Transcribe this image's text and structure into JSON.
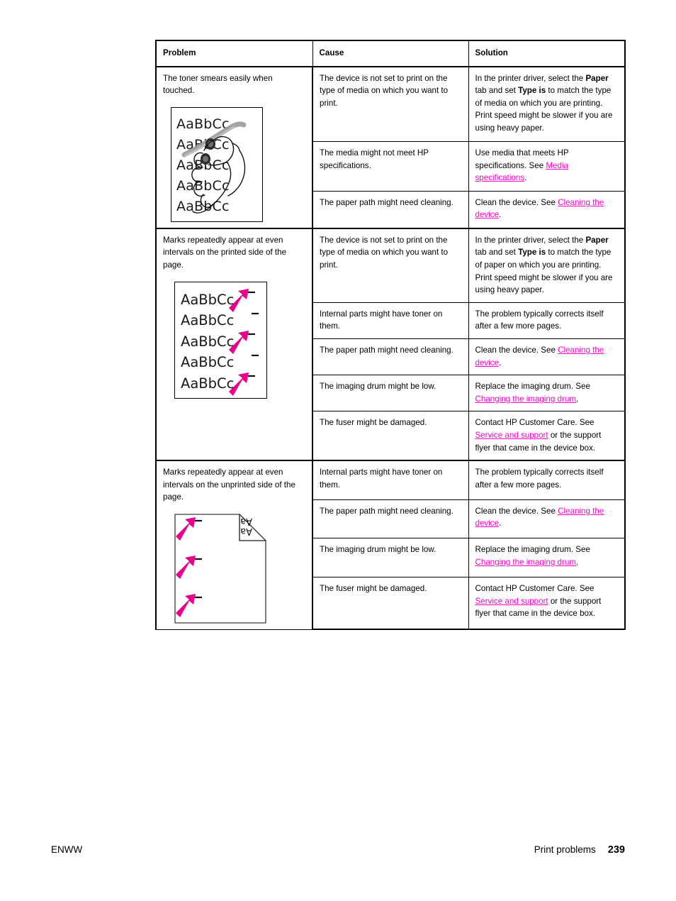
{
  "document": {
    "footer_left": "ENWW",
    "footer_section": "Print problems",
    "footer_page": "239"
  },
  "colors": {
    "link": "#ff00cc",
    "text": "#000000",
    "arrow": "#e8008c",
    "border": "#000000"
  },
  "table": {
    "headers": {
      "problem": "Problem",
      "cause": "Cause",
      "solution": "Solution"
    },
    "groups": [
      {
        "problem_text": "The toner smears easily when touched.",
        "figure": "toner-smear-hand-illustration",
        "figure_sample_lines": [
          "AaBbCc",
          "AaBbCc",
          "AaBbCc",
          "AaBbCc",
          "AaBbCc"
        ],
        "rows": [
          {
            "cause": "The device is not set to print on the type of media on which you want to print.",
            "solution_parts": [
              {
                "t": "text",
                "v": "In the printer driver, select the "
              },
              {
                "t": "bold",
                "v": "Paper"
              },
              {
                "t": "text",
                "v": " tab and set "
              },
              {
                "t": "bold",
                "v": "Type is"
              },
              {
                "t": "text",
                "v": " to match the type of media on which you are printing. Print speed might be slower if you are using heavy paper."
              }
            ]
          },
          {
            "cause": "The media might not meet HP specifications.",
            "solution_parts": [
              {
                "t": "text",
                "v": "Use media that meets HP specifications. See "
              },
              {
                "t": "link",
                "v": "Media specifications"
              },
              {
                "t": "text",
                "v": "."
              }
            ]
          },
          {
            "cause": "The paper path might need cleaning.",
            "solution_parts": [
              {
                "t": "text",
                "v": "Clean the device. See "
              },
              {
                "t": "link",
                "v": "Cleaning the device"
              },
              {
                "t": "text",
                "v": "."
              }
            ]
          }
        ]
      },
      {
        "problem_text": "Marks repeatedly appear at even intervals on the printed side of the page.",
        "figure": "repeated-marks-printed-side-illustration",
        "figure_sample_lines": [
          "AaBbCc",
          "AaBbCc",
          "AaBbCc",
          "AaBbCc",
          "AaBbCc"
        ],
        "rows": [
          {
            "cause": "The device is not set to print on the type of media on which you want to print.",
            "solution_parts": [
              {
                "t": "text",
                "v": "In the printer driver, select the "
              },
              {
                "t": "bold",
                "v": "Paper"
              },
              {
                "t": "text",
                "v": " tab and set "
              },
              {
                "t": "bold",
                "v": "Type is"
              },
              {
                "t": "text",
                "v": " to match the type of paper on which you are printing. Print speed might be slower if you are using heavy paper."
              }
            ]
          },
          {
            "cause": "Internal parts might have toner on them.",
            "solution_parts": [
              {
                "t": "text",
                "v": "The problem typically corrects itself after a few more pages."
              }
            ]
          },
          {
            "cause": "The paper path might need cleaning.",
            "solution_parts": [
              {
                "t": "text",
                "v": "Clean the device. See "
              },
              {
                "t": "link",
                "v": "Cleaning the device"
              },
              {
                "t": "text",
                "v": "."
              }
            ]
          },
          {
            "cause": "The imaging drum might be low.",
            "solution_parts": [
              {
                "t": "text",
                "v": "Replace the imaging drum. See "
              },
              {
                "t": "link",
                "v": "Changing the imaging drum"
              },
              {
                "t": "text",
                "v": "."
              }
            ]
          },
          {
            "cause": "The fuser might be damaged.",
            "solution_parts": [
              {
                "t": "text",
                "v": "Contact HP Customer Care. See "
              },
              {
                "t": "link",
                "v": "Service and support"
              },
              {
                "t": "text",
                "v": " or the support flyer that came in the device box."
              }
            ]
          }
        ]
      },
      {
        "problem_text": "Marks repeatedly appear at even intervals on the unprinted side of the page.",
        "figure": "repeated-marks-unprinted-side-illustration",
        "figure_sample_lines": [],
        "rows": [
          {
            "cause": "Internal parts might have toner on them.",
            "solution_parts": [
              {
                "t": "text",
                "v": "The problem typically corrects itself after a few more pages."
              }
            ]
          },
          {
            "cause": "The paper path might need cleaning.",
            "solution_parts": [
              {
                "t": "text",
                "v": "Clean the device. See "
              },
              {
                "t": "link",
                "v": "Cleaning the device"
              },
              {
                "t": "text",
                "v": "."
              }
            ]
          },
          {
            "cause": "The imaging drum might be low.",
            "solution_parts": [
              {
                "t": "text",
                "v": "Replace the imaging drum. See "
              },
              {
                "t": "link",
                "v": "Changing the imaging drum"
              },
              {
                "t": "text",
                "v": "."
              }
            ]
          },
          {
            "cause": "The fuser might be damaged.",
            "solution_parts": [
              {
                "t": "text",
                "v": "Contact HP Customer Care. See "
              },
              {
                "t": "link",
                "v": "Service and support"
              },
              {
                "t": "text",
                "v": " or the support flyer that came in the device box."
              }
            ]
          }
        ]
      }
    ]
  }
}
